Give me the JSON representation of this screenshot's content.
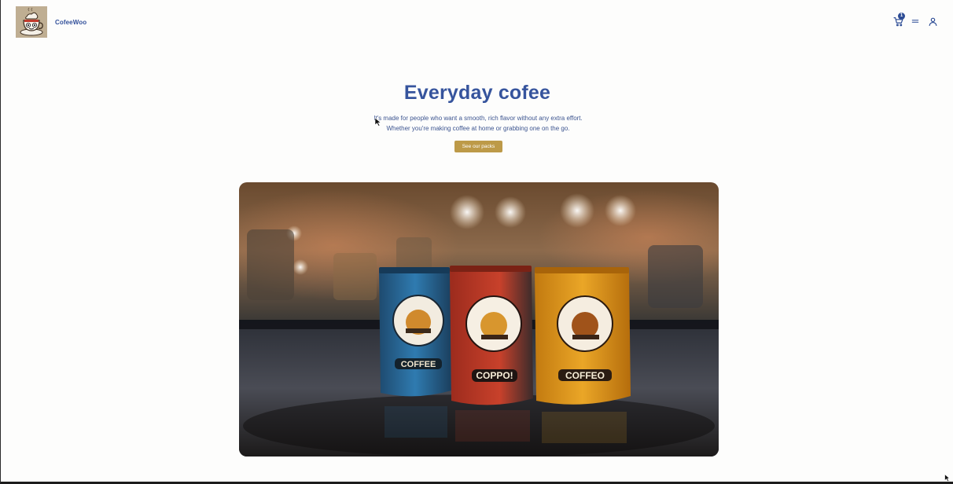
{
  "header": {
    "brand_name": "CofeeWoo",
    "logo_icon": "coffee-mascot-logo",
    "cart": {
      "icon": "cart-icon",
      "count": "1"
    },
    "menu_icon": "menu-icon",
    "account_icon": "user-icon"
  },
  "hero": {
    "title": "Everyday cofee",
    "description": "It's made for people who want a smooth, rich flavor without any extra effort. Whether you're making coffee at home or grabbing one on the go.",
    "cta_label": "See our packs"
  },
  "product_image": {
    "bag_labels": [
      "COFFEE",
      "COPPO!",
      "COFFEO"
    ]
  },
  "colors": {
    "brand_blue": "#36549d",
    "cta_gold": "#bd9a48",
    "background": "#fdfdfc"
  }
}
